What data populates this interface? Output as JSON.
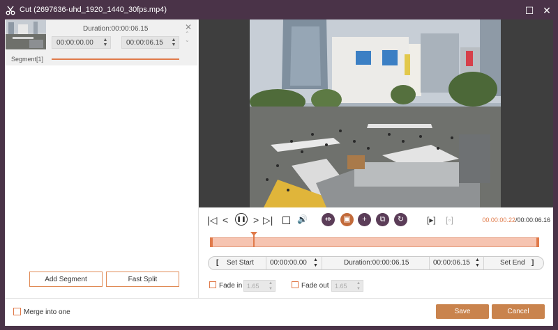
{
  "window": {
    "title": "Cut (2697636-uhd_1920_1440_30fps.mp4)",
    "minimize_glyph": "☐",
    "close_glyph": "✕",
    "app_icon": "scissors-icon"
  },
  "segment": {
    "duration_label": "Duration:00:00:06.15",
    "start_time": "00:00:00.00",
    "end_time": "00:00:06.15",
    "label": "Segment[1]",
    "close_glyph": "✕",
    "up_glyph": "⌃",
    "down_glyph": "⌄"
  },
  "left_actions": {
    "add_segment": "Add Segment",
    "fast_split": "Fast Split"
  },
  "controls": {
    "current_time": "00:00:00.22",
    "total_time": "/00:00:06.16",
    "icons": [
      "jump-start-icon",
      "prev-frame-icon",
      "pause-icon",
      "next-frame-icon",
      "jump-end-icon",
      "stop-icon",
      "volume-icon",
      "split-icon",
      "crop-icon",
      "add-icon",
      "copy-icon",
      "reset-icon",
      "mark-in-icon",
      "mark-out-icon"
    ]
  },
  "timeline": {
    "playhead_position": 0.036
  },
  "set_bar": {
    "open_bracket": "[",
    "set_start": "Set Start",
    "start_time": "00:00:00.00",
    "duration": "Duration:00:00:06.15",
    "end_time": "00:00:06.15",
    "set_end": "Set End",
    "close_bracket": "]"
  },
  "fade": {
    "fade_in_label": "Fade in",
    "fade_in_value": "1.65",
    "fade_out_label": "Fade out",
    "fade_out_value": "1.65"
  },
  "bottom": {
    "merge_label": "Merge into one",
    "save": "Save",
    "cancel": "Cancel"
  },
  "colors": {
    "accent": "#e07a4a",
    "title_bar": "#4a3348",
    "button_fill": "#c9834d"
  }
}
